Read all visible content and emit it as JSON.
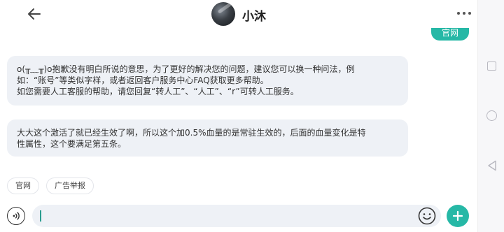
{
  "header": {
    "title": "小沐"
  },
  "chat": {
    "user_message": "官网",
    "bot_messages": [
      {
        "line1": "o(╥﹏╥)o抱歉没有明白所说的意思，为了更好的解决您的问题，建议您可以换一种问法，例",
        "line2": "如：“账号”等类似字样，或者返回客户服务中心FAQ获取更多帮助。",
        "line3": "如您需要人工客服的帮助，请您回复“转人工”、“人工”、“r”可转人工服务。"
      },
      {
        "line1": "大大这个激活了就已经生效了啊，所以这个加0.5%血量的是常驻生效的，后面的血量变化是特",
        "line2": "性属性，这个要满足第五条。"
      }
    ]
  },
  "quick_replies": [
    "官网",
    "广告举报"
  ],
  "input": {
    "value": ""
  },
  "colors": {
    "accent": "#26b8a6",
    "bubble_bg": "#eef1f6"
  },
  "icons": [
    "back-arrow-icon",
    "more-dots-icon",
    "voice-icon",
    "emoji-icon",
    "plus-icon",
    "nav-square-icon",
    "nav-circle-icon",
    "nav-back-icon"
  ]
}
